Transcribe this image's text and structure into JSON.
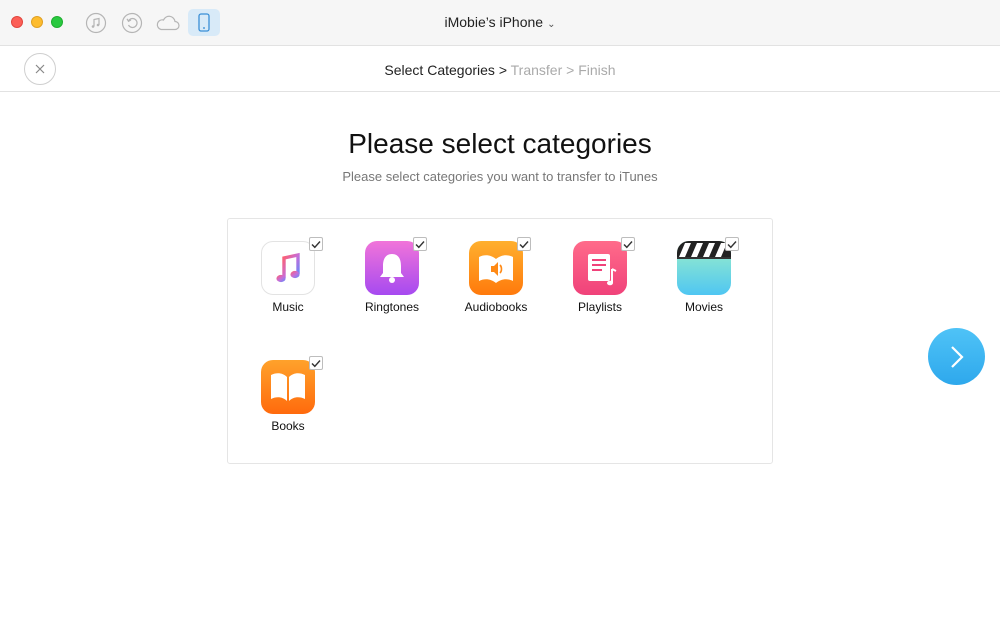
{
  "window": {
    "device_name": "iMobie’s iPhone"
  },
  "toolbar": {
    "icons": [
      "music-note-icon",
      "restore-icon",
      "cloud-icon",
      "phone-icon"
    ]
  },
  "steps": {
    "current": "Select Categories",
    "sep1": ">",
    "next": "Transfer",
    "sep2": ">",
    "last": "Finish"
  },
  "main": {
    "title": "Please select categories",
    "subtitle": "Please select categories you want to transfer to iTunes"
  },
  "categories": [
    {
      "label": "Music",
      "checked": true,
      "icon": "music-icon"
    },
    {
      "label": "Ringtones",
      "checked": true,
      "icon": "bell-icon"
    },
    {
      "label": "Audiobooks",
      "checked": true,
      "icon": "audiobook-icon"
    },
    {
      "label": "Playlists",
      "checked": true,
      "icon": "playlist-icon"
    },
    {
      "label": "Movies",
      "checked": true,
      "icon": "clapperboard-icon"
    },
    {
      "label": "Books",
      "checked": true,
      "icon": "book-icon"
    }
  ],
  "colors": {
    "accent": "#2ea8ec",
    "device_tab_bg": "#d8eaf8"
  }
}
